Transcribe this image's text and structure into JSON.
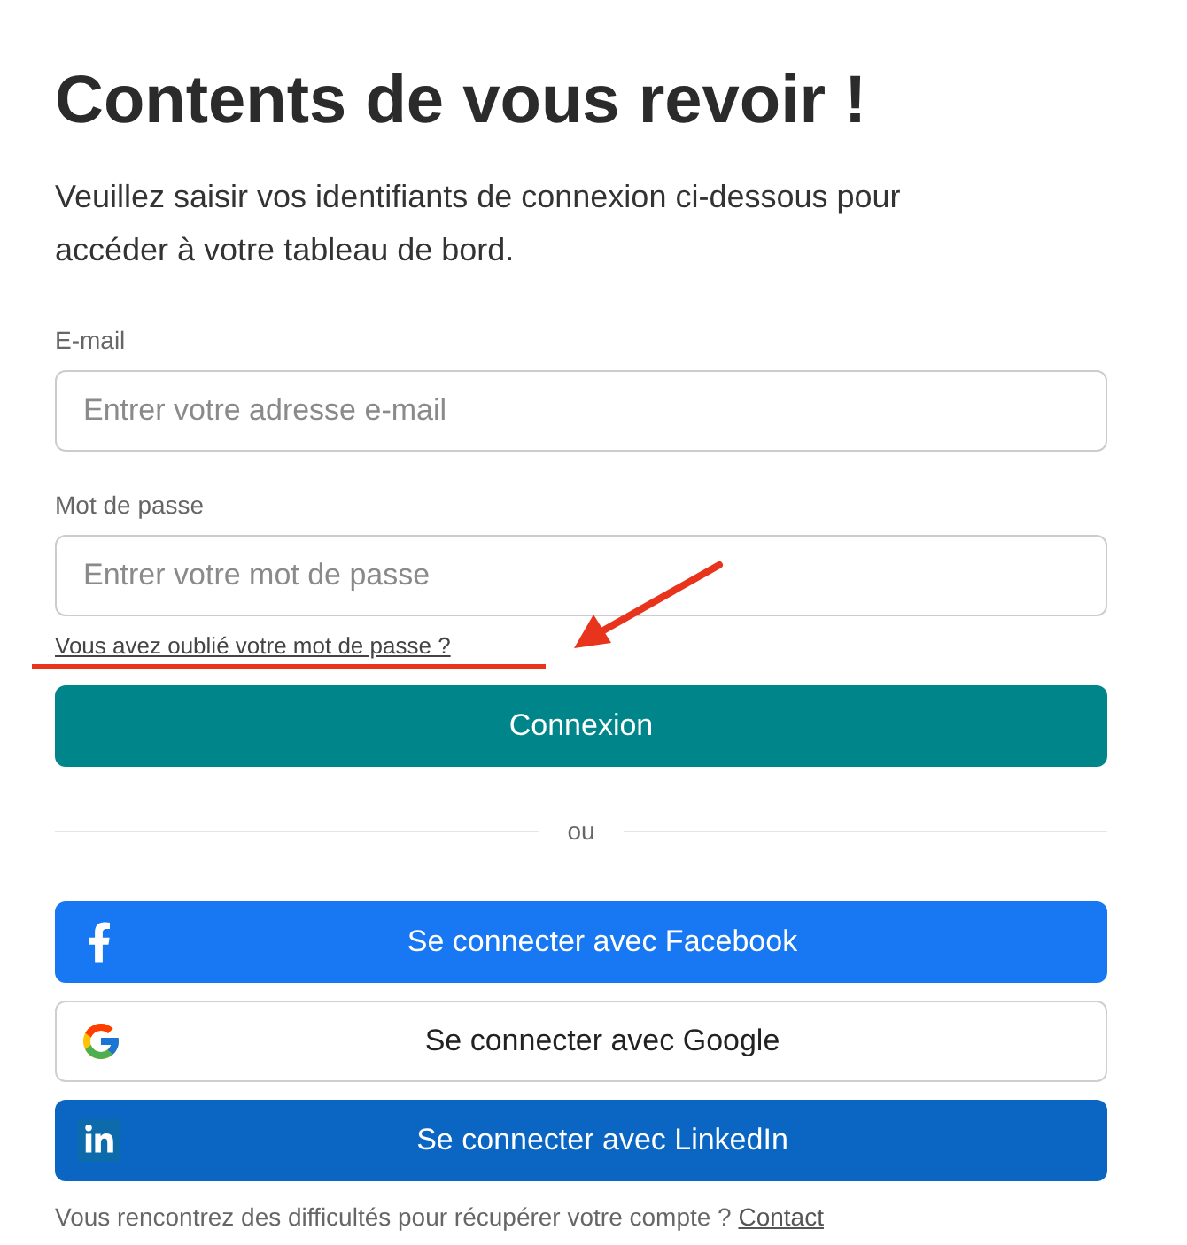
{
  "heading": "Contents de vous revoir !",
  "intro": "Veuillez saisir vos identifiants de connexion ci-dessous pour accéder à votre tableau de bord.",
  "form": {
    "fields": [
      {
        "label": "E-mail",
        "placeholder": "Entrer votre adresse e-mail"
      },
      {
        "label": "Mot de passe",
        "placeholder": "Entrer votre mot de passe"
      }
    ],
    "forgot_link": "Vous avez oublié votre mot de passe ?",
    "submit": "Connexion"
  },
  "divider": "ou",
  "social_buttons": [
    {
      "kind": "facebook",
      "label": "Se connecter avec Facebook"
    },
    {
      "kind": "google",
      "label": "Se connecter avec Google"
    },
    {
      "kind": "linkedin",
      "label": "Se connecter avec LinkedIn"
    }
  ],
  "footer": {
    "text": "Vous rencontrez des difficultés pour récupérer votre compte ?",
    "link": "Contact"
  }
}
